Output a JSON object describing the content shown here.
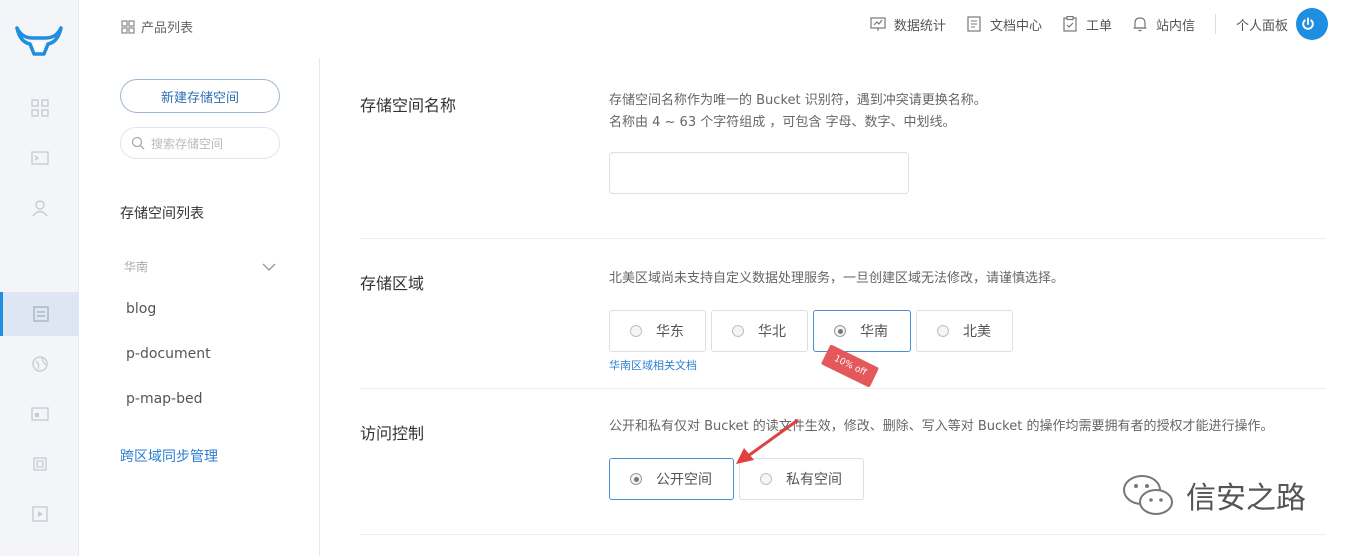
{
  "header": {
    "product_list": "产品列表",
    "nav": [
      {
        "label": "数据统计",
        "icon": "chart-icon"
      },
      {
        "label": "文档中心",
        "icon": "document-icon"
      },
      {
        "label": "工单",
        "icon": "ticket-icon"
      },
      {
        "label": "站内信",
        "icon": "bell-icon"
      }
    ],
    "personal_panel": "个人面板"
  },
  "sidebar": {
    "new_bucket": "新建存储空间",
    "search_placeholder": "搜索存储空间",
    "list_title": "存储空间列表",
    "region": "华南",
    "buckets": [
      "blog",
      "p-document",
      "p-map-bed"
    ],
    "cross_region_sync": "跨区域同步管理"
  },
  "form": {
    "name": {
      "label": "存储空间名称",
      "desc_line1": "存储空间名称作为唯一的 Bucket 识别符，遇到冲突请更换名称。",
      "desc_line2": "名称由 4 ~ 63 个字符组成 ，可包含 字母、数字、中划线。",
      "value": ""
    },
    "region": {
      "label": "存储区域",
      "desc": "北美区域尚未支持自定义数据处理服务，一旦创建区域无法修改，请谨慎选择。",
      "options": [
        "华东",
        "华北",
        "华南",
        "北美"
      ],
      "selected": "华南",
      "doc_link": "华南区域相关文档",
      "promo_tag": "10% off"
    },
    "access": {
      "label": "访问控制",
      "desc": "公开和私有仅对 Bucket 的读文件生效，修改、删除、写入等对 Bucket 的操作均需要拥有者的授权才能进行操作。",
      "options": [
        "公开空间",
        "私有空间"
      ],
      "selected": "公开空间"
    }
  },
  "watermark": "信安之路",
  "colors": {
    "accent": "#1d8ee0",
    "link": "#2d7fd0",
    "tag": "#e4575b"
  }
}
